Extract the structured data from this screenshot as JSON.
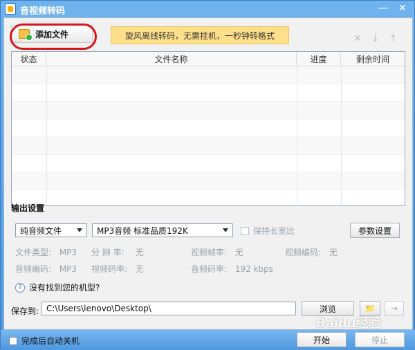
{
  "window": {
    "title": "音视频转码"
  },
  "toolbar": {
    "add_file_label": "添加文件",
    "promo_text": "旋风离线转码，无需挂机，一秒钟转格式"
  },
  "file_list": {
    "columns": [
      "状态",
      "文件名称",
      "进度",
      "剩余时间"
    ]
  },
  "output": {
    "section_title": "输出设置",
    "format_select": "纯音频文件",
    "quality_select": "MP3音频 标准品质192K",
    "keep_ratio_label": "保持长宽比",
    "params_button": "参数设置",
    "info": [
      {
        "label": "文件类型:",
        "value": "MP3"
      },
      {
        "label": "分 辨 率:",
        "value": "无"
      },
      {
        "label": "视频帧率:",
        "value": "无"
      },
      {
        "label": "视频编码:",
        "value": "无"
      },
      {
        "label": "音频编码:",
        "value": "MP3"
      },
      {
        "label": "视频码率:",
        "value": "无"
      },
      {
        "label": "音频码率:",
        "value": "192 kbps"
      }
    ],
    "help_text": "没有找到您的机型?"
  },
  "save": {
    "label": "保存到:",
    "path": "C:\\Users\\lenovo\\Desktop\\",
    "browse_button": "浏览"
  },
  "footer": {
    "auto_shutdown_label": "完成后自动关机",
    "start_button": "开始",
    "stop_button": "停止",
    "watermark": "Baidu经验"
  }
}
